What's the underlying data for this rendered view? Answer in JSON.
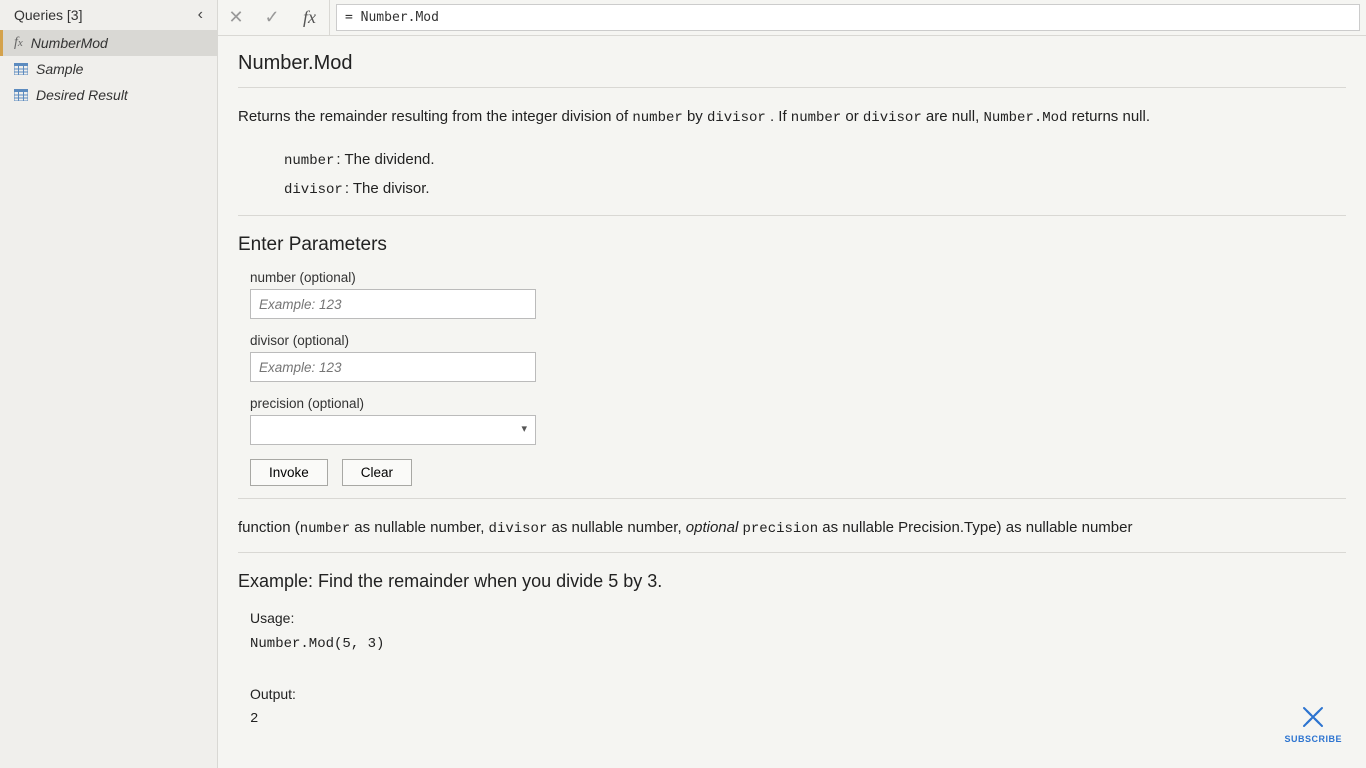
{
  "sidebar": {
    "title": "Queries [3]",
    "items": [
      {
        "label": "NumberMod",
        "icon": "fx",
        "active": true
      },
      {
        "label": "Sample",
        "icon": "table",
        "active": false
      },
      {
        "label": "Desired Result",
        "icon": "table",
        "active": false
      }
    ]
  },
  "formula_bar": {
    "fx_label": "fx",
    "value": "= Number.Mod"
  },
  "doc": {
    "title": "Number.Mod",
    "description_parts": {
      "pre": "Returns the remainder resulting from the integer division of ",
      "c1": "number",
      "mid1": " by ",
      "c2": "divisor",
      "mid2": ". If ",
      "c3": "number",
      "mid3": " or ",
      "c4": "divisor",
      "mid4": " are null, ",
      "c5": "Number.Mod",
      "post": " returns null."
    },
    "param_defs": [
      {
        "name": "number",
        "text": ": The dividend."
      },
      {
        "name": "divisor",
        "text": ": The divisor."
      }
    ],
    "enter_params_title": "Enter Parameters",
    "params_form": {
      "number": {
        "label": "number (optional)",
        "placeholder": "Example: 123"
      },
      "divisor": {
        "label": "divisor (optional)",
        "placeholder": "Example: 123"
      },
      "precision": {
        "label": "precision (optional)"
      }
    },
    "buttons": {
      "invoke": "Invoke",
      "clear": "Clear"
    },
    "signature_parts": {
      "pre": "function (",
      "c1": "number",
      "t1": " as nullable number, ",
      "c2": "divisor",
      "t2": " as nullable number, ",
      "opt": "optional",
      "sp": " ",
      "c3": "precision",
      "t3": " as nullable Precision.Type) as nullable number"
    },
    "example": {
      "heading": "Example: Find the remainder when you divide 5 by 3.",
      "usage_label": "Usage:",
      "usage_code": "Number.Mod(5, 3)",
      "output_label": "Output:",
      "output_value": "2"
    }
  },
  "subscribe": {
    "label": "SUBSCRIBE"
  }
}
